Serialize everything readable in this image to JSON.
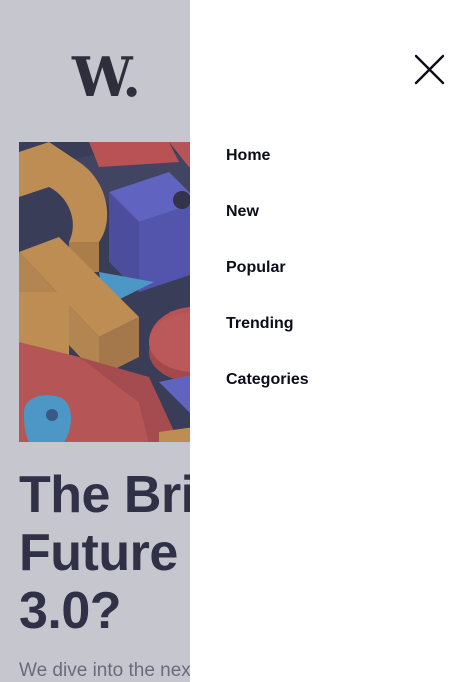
{
  "brand": {
    "logo_text": "W."
  },
  "article": {
    "headline_lines": [
      "The Bright",
      "Future of Web",
      "3.0?"
    ],
    "excerpt": "We dive into the next evolution of the web"
  },
  "menu": {
    "close_label": "Close menu",
    "items": [
      {
        "label": "Home"
      },
      {
        "label": "New"
      },
      {
        "label": "Popular"
      },
      {
        "label": "Trending"
      },
      {
        "label": "Categories"
      }
    ]
  },
  "colors": {
    "text_dark": "#0d0d24",
    "scrim": "rgba(105,105,125,0.38)",
    "drawer_bg": "#ffffff"
  }
}
